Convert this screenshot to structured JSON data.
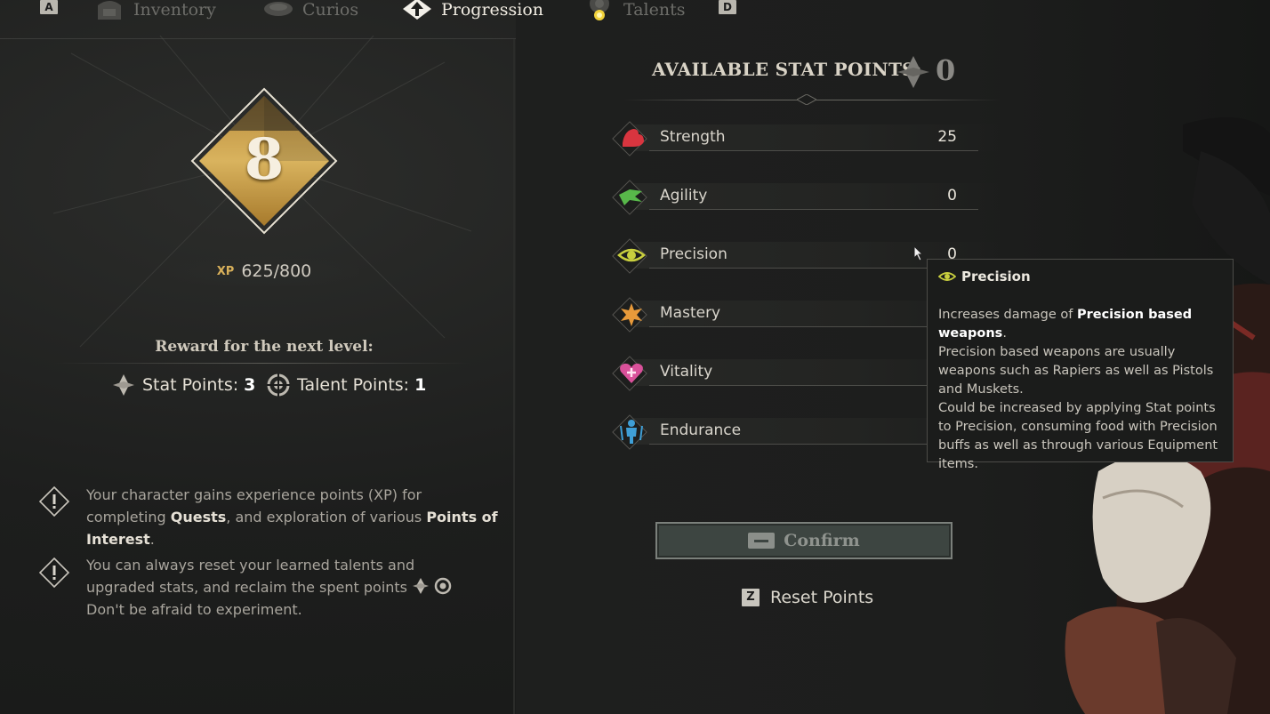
{
  "nav": {
    "left_key": "A",
    "right_key": "D",
    "tabs": [
      {
        "label": "Inventory",
        "active": false
      },
      {
        "label": "Curios",
        "active": false
      },
      {
        "label": "Progression",
        "active": true
      },
      {
        "label": "Talents",
        "active": false
      }
    ]
  },
  "level": {
    "number": "8",
    "xp_tag": "XP",
    "xp": "625/800",
    "xp_progress": 0.78125
  },
  "reward": {
    "title": "Reward for the next level:",
    "stat_label": "Stat Points: ",
    "stat_value": "3",
    "talent_label": "Talent Points: ",
    "talent_value": "1"
  },
  "tips": {
    "tip1": {
      "a": "Your character gains experience points (XP) for completing ",
      "b": "Quests",
      "c": ", and exploration of various ",
      "d": "Points of Interest",
      "e": "."
    },
    "tip2": {
      "a": "You can always reset your learned talents and upgraded stats, and reclaim the spent points",
      "b": "Don't be afraid to experiment."
    }
  },
  "stats_panel": {
    "available_label": "AVAILABLE STAT POINTS:",
    "available_value": "0",
    "stats": [
      {
        "name": "Strength",
        "value": "25",
        "icon": "strength-icon",
        "color": "#d8353f"
      },
      {
        "name": "Agility",
        "value": "0",
        "icon": "agility-icon",
        "color": "#58b84a"
      },
      {
        "name": "Precision",
        "value": "0",
        "icon": "precision-icon",
        "color": "#c9cf3e"
      },
      {
        "name": "Mastery",
        "value": "",
        "icon": "mastery-icon",
        "color": "#e89a3a"
      },
      {
        "name": "Vitality",
        "value": "",
        "icon": "vitality-icon",
        "color": "#d9519a"
      },
      {
        "name": "Endurance",
        "value": "",
        "icon": "endurance-icon",
        "color": "#3f9fd6"
      }
    ],
    "confirm_label": "Confirm",
    "reset_key": "Z",
    "reset_label": "Reset Points"
  },
  "tooltip": {
    "title": "Precision",
    "p1_a": "Increases damage of ",
    "p1_b": "Precision based weapons",
    "p1_c": ".",
    "p2": "Precision based weapons are usually weapons such as Rapiers as well as Pistols and Muskets.",
    "p3": "Could be increased by applying Stat points to Precision, consuming food with Precision buffs as well as through various Equipment items."
  },
  "colors": {
    "gold": "#c89a3c",
    "accent_text": "#f1ece2",
    "confirm_bg": "#3d4541"
  }
}
